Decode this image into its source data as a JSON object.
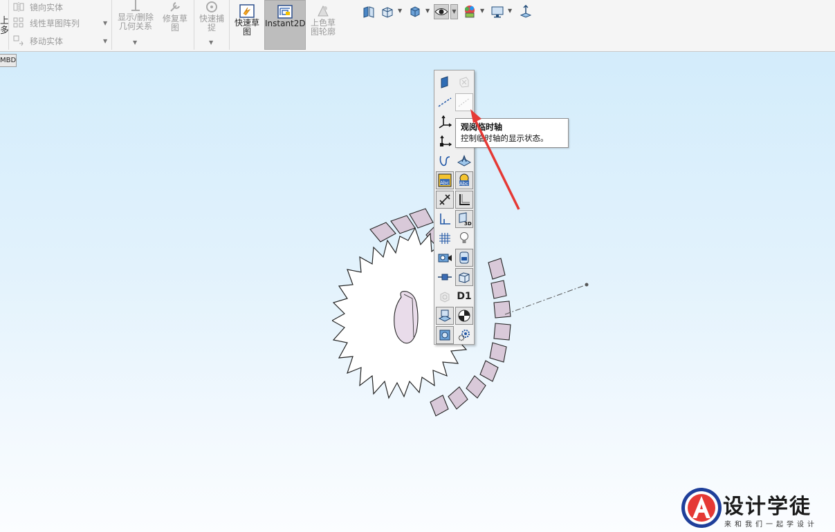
{
  "ribbon": {
    "left_stub_line1": "上",
    "left_stub_line2": "多",
    "small_commands": [
      {
        "label": "镜向实体",
        "icon": "mirror-entities-icon"
      },
      {
        "label": "线性草图阵列",
        "icon": "linear-pattern-icon"
      },
      {
        "label": "移动实体",
        "icon": "move-entities-icon"
      }
    ],
    "big_commands": {
      "relations_line1": "显示/删除",
      "relations_line2": "几何关系",
      "repair_line1": "修复草",
      "repair_line2": "图",
      "snap_line1": "快速捕",
      "snap_line2": "捉",
      "rapid_sketch_line1": "快速草",
      "rapid_sketch_line2": "图",
      "instant2d": "Instant2D",
      "shaded_line1": "上色草",
      "shaded_line2": "图轮廓"
    }
  },
  "viewport": {
    "mbd_tab": "MBD"
  },
  "hud_icons": [
    "view-orientation-icon",
    "section-view-icon",
    "display-style-icon",
    "hide-show-items-icon",
    "edit-appearance-icon",
    "apply-scene-icon",
    "view-settings-icon"
  ],
  "flyout": {
    "items": [
      {
        "icon": "view-planes-icon"
      },
      {
        "icon": "view-planes-disabled-icon"
      },
      {
        "icon": "view-axes-icon"
      },
      {
        "icon": "view-temporary-axes-icon"
      },
      {
        "icon": "view-origins-icon"
      },
      {
        "icon": "view-coordinate-systems-icon"
      },
      {
        "icon": "view-curves-icon"
      },
      {
        "icon": "view-sketches-icon"
      },
      {
        "icon": "view-annotations-icon"
      },
      {
        "icon": "view-dimension-names-icon"
      },
      {
        "icon": "view-sketch-relations-icon"
      },
      {
        "icon": "view-weld-beads-icon"
      },
      {
        "icon": "view-routing-points-icon"
      },
      {
        "icon": "view-3d-sketch-icon"
      },
      {
        "icon": "view-grid-icon"
      },
      {
        "icon": "view-lights-icon"
      },
      {
        "icon": "view-cameras-icon"
      },
      {
        "icon": "view-decals-icon"
      },
      {
        "icon": "view-parting-lines-icon"
      },
      {
        "icon": "view-bodies-icon"
      },
      {
        "icon": "view-parts-disabled-icon"
      },
      {
        "icon": "view-primary-dimension-icon",
        "text": "D1"
      },
      {
        "icon": "view-sketch-plane-icon"
      },
      {
        "icon": "view-center-of-mass-icon"
      },
      {
        "icon": "view-assembly-icon"
      },
      {
        "icon": "view-settings-gears-icon"
      }
    ]
  },
  "tooltip": {
    "title": "观阅临时轴",
    "description": "控制临时轴的显示状态。"
  },
  "brand": {
    "name": "设计学徒",
    "slogan": "来和我们一起学设计",
    "logo_letter": "A"
  },
  "colors": {
    "annotation_arrow": "#e53935",
    "gear_face": "#ffffff",
    "gear_teeth": "#d9c9d9",
    "viewport_top": "#d3ecfb"
  }
}
